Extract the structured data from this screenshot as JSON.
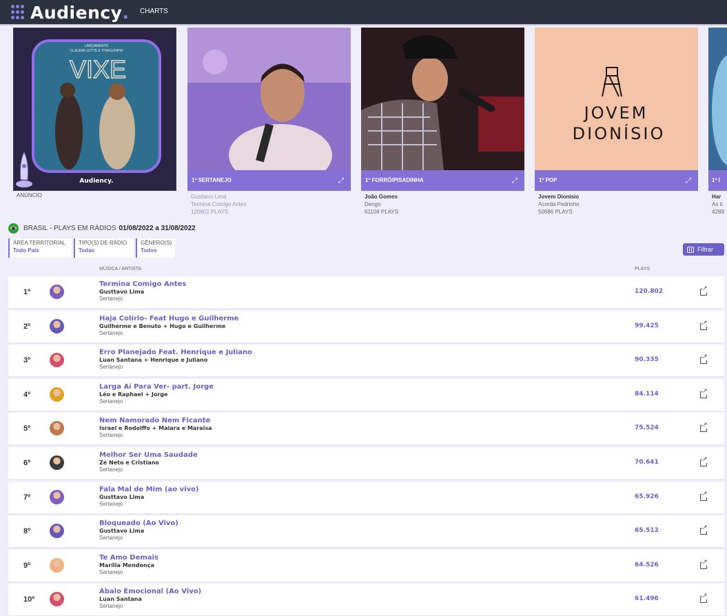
{
  "topbar": {
    "logo": "Audiency",
    "nav_charts": "CHARTS"
  },
  "cards": [
    {
      "type": "ad",
      "label": "ANÚNCIO",
      "ad_lines": [
        "LANÇAMENTO",
        "CLAUDIA LEITTE E THIAGUINHO",
        "VIXE"
      ],
      "ad_brand": "Audiency."
    },
    {
      "rank_label": "1º SERTANEJO",
      "artist": "Gusttavo Lima",
      "song": "Termina Comigo Antes",
      "plays": "120802 PLAYS"
    },
    {
      "rank_label": "1º FORRÓ/PISADINHA",
      "artist": "João Gomes",
      "song": "Dengo",
      "plays": "61106 PLAYS"
    },
    {
      "rank_label": "1º POP",
      "artist": "Jovem Dionisio",
      "song": "Acorda Pedrinho",
      "plays": "50986 PLAYS",
      "cover_text": [
        "JOVEM",
        "DIONÍSIO"
      ]
    },
    {
      "rank_label": "1º I",
      "artist": "Har",
      "song": "As it",
      "plays": "4289"
    }
  ],
  "heading": {
    "region": "BRASIL - PLAYS EM RÁDIOS",
    "period": "01/08/2022 a 31/08/2022"
  },
  "filters": [
    {
      "title": "ÁREA TERRITORIAL",
      "value": "Todo País"
    },
    {
      "title": "TIPO(S) DE RÁDIO",
      "value": "Todas"
    },
    {
      "title": "GÊNERO(S)",
      "value": "Todos"
    }
  ],
  "filter_button": "Filtrar",
  "columns": {
    "music_artist": "MÚSICA / ARTISTA",
    "plays": "PLAYS"
  },
  "colors": {
    "accent": "#6b5fc6",
    "topbar": "#2a3240",
    "background": "#f1eefb"
  },
  "rows": [
    {
      "rank": "1º",
      "song": "Termina Comigo Antes",
      "artist": "Gusttavo Lima",
      "genre": "Sertanejo",
      "plays": "120.802",
      "avatar_color": "#7d5ec0"
    },
    {
      "rank": "2º",
      "song": "Haja Colírio- Feat Hugo e Guilherme",
      "artist": "Guilherme e Benuto + Hugo e Guilherme",
      "genre": "Sertanejo",
      "plays": "99.425",
      "avatar_color": "#6a58b8"
    },
    {
      "rank": "3º",
      "song": "Erro Planejado Feat. Henrique e Juliano",
      "artist": "Luan Santana + Henrique e Juliano",
      "genre": "Sertanejo",
      "plays": "90.335",
      "avatar_color": "#d4506e"
    },
    {
      "rank": "4º",
      "song": "Larga Aí Para Ver- part. Jorge",
      "artist": "Léo e Raphael + Jorge",
      "genre": "Sertanejo",
      "plays": "84.114",
      "avatar_color": "#e0a020"
    },
    {
      "rank": "5º",
      "song": "Nem Namorado Nem Ficante",
      "artist": "Israel e Rodolffo + Maiara e Maraisa",
      "genre": "Sertanejo",
      "plays": "75.524",
      "avatar_color": "#c07848"
    },
    {
      "rank": "6º",
      "song": "Melhor Ser Uma Saudade",
      "artist": "Zé Neto e Cristiano",
      "genre": "Sertanejo",
      "plays": "70.641",
      "avatar_color": "#3a3a3a"
    },
    {
      "rank": "7º",
      "song": "Fala Mal de Mim (ao vivo)",
      "artist": "Gusttavo Lima",
      "genre": "Sertanejo",
      "plays": "65.926",
      "avatar_color": "#7d5ec0"
    },
    {
      "rank": "8º",
      "song": "Bloqueado (Ao Vivo)",
      "artist": "Gusttavo Lima",
      "genre": "Sertanejo",
      "plays": "65.512",
      "avatar_color": "#6a58b8"
    },
    {
      "rank": "9º",
      "song": "Te Amo Demais",
      "artist": "Marília Mendonça",
      "genre": "Sertanejo",
      "plays": "64.526",
      "avatar_color": "#f0b080"
    },
    {
      "rank": "10º",
      "song": "Abalo Emocional (Ao Vivo)",
      "artist": "Luan Santana",
      "genre": "Sertanejo",
      "plays": "61.496",
      "avatar_color": "#d4506e"
    }
  ]
}
